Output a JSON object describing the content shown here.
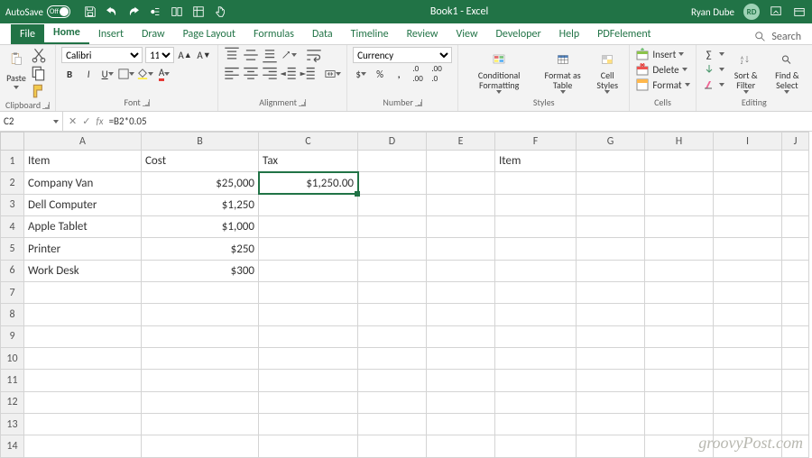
{
  "title_bar": {
    "autosave_label": "AutoSave",
    "autosave_state": "Off",
    "doc_title": "Book1 - Excel",
    "user_name": "Ryan Dube",
    "user_initials": "RD"
  },
  "menu": {
    "tabs": [
      "File",
      "Home",
      "Insert",
      "Draw",
      "Page Layout",
      "Formulas",
      "Data",
      "Timeline",
      "Review",
      "View",
      "Developer",
      "Help",
      "PDFelement"
    ],
    "active": "Home",
    "search": "Search"
  },
  "ribbon": {
    "clipboard": {
      "paste": "Paste",
      "label": "Clipboard"
    },
    "font": {
      "name": "Calibri",
      "size": "11",
      "label": "Font"
    },
    "alignment": {
      "label": "Alignment"
    },
    "number": {
      "format": "Currency",
      "label": "Number"
    },
    "styles": {
      "cond": "Conditional Formatting",
      "fmt_table": "Format as Table",
      "cell_styles": "Cell Styles",
      "label": "Styles"
    },
    "cells": {
      "insert": "Insert",
      "delete": "Delete",
      "format": "Format",
      "label": "Cells"
    },
    "editing": {
      "sort": "Sort & Filter",
      "find": "Find & Select",
      "label": "Editing"
    }
  },
  "formula_bar": {
    "cell_ref": "C2",
    "fx": "fx",
    "formula": "=B2*0.05"
  },
  "columns": [
    "A",
    "B",
    "C",
    "D",
    "E",
    "F",
    "G",
    "H",
    "I",
    "J"
  ],
  "rows": [
    "1",
    "2",
    "3",
    "4",
    "5",
    "6",
    "7",
    "8",
    "9",
    "10",
    "11",
    "12",
    "13",
    "14"
  ],
  "sheet": {
    "headers": {
      "A1": "Item",
      "B1": "Cost",
      "C1": "Tax",
      "F1": "Item"
    },
    "data": [
      {
        "item": "Company Van",
        "cost": "$25,000",
        "tax": "$1,250.00"
      },
      {
        "item": "Dell Computer",
        "cost": "$1,250",
        "tax": ""
      },
      {
        "item": "Apple Tablet",
        "cost": "$1,000",
        "tax": ""
      },
      {
        "item": "Printer",
        "cost": "$250",
        "tax": ""
      },
      {
        "item": "Work Desk",
        "cost": "$300",
        "tax": ""
      }
    ]
  },
  "watermark": "groovyPost.com"
}
